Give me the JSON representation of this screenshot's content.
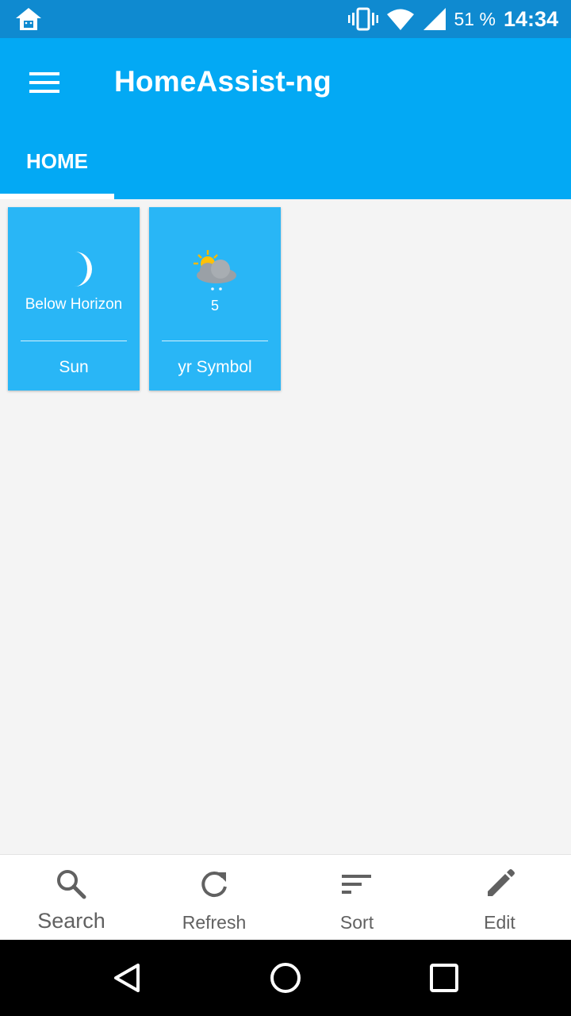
{
  "status_bar": {
    "battery": "51 %",
    "time": "14:34",
    "icons": [
      "home-icon",
      "vibrate-icon",
      "wifi-icon",
      "signal-icon"
    ]
  },
  "app_bar": {
    "title": "HomeAssist-ng",
    "tabs": [
      {
        "label": "HOME",
        "selected": true
      }
    ]
  },
  "tiles": [
    {
      "state": "Below Horizon",
      "name": "Sun",
      "icon": "moon-icon"
    },
    {
      "state": "5",
      "name": "yr Symbol",
      "icon": "partly-cloudy-rain-icon"
    }
  ],
  "bottom_nav": {
    "items": [
      {
        "label": "Search",
        "icon": "search-icon"
      },
      {
        "label": "Refresh",
        "icon": "refresh-icon"
      },
      {
        "label": "Sort",
        "icon": "sort-icon"
      },
      {
        "label": "Edit",
        "icon": "edit-icon"
      }
    ]
  },
  "system_nav": [
    "back-button",
    "home-button",
    "recents-button"
  ],
  "colors": {
    "status_bar": "#0f8ad0",
    "app_bar": "#03a9f4",
    "tile": "#29b6f6",
    "background": "#f4f4f4"
  }
}
